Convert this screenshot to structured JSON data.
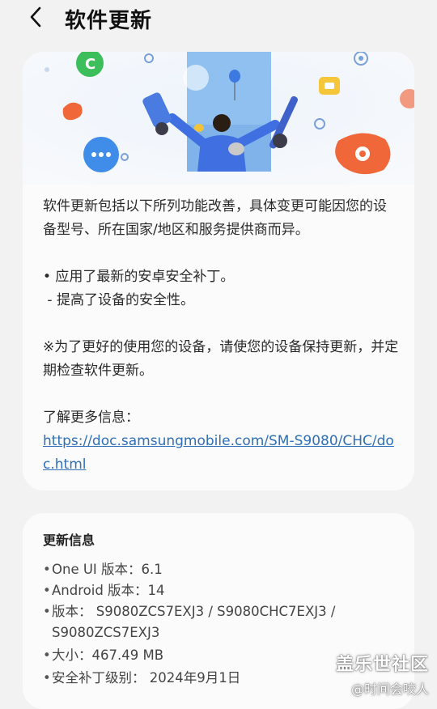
{
  "header": {
    "title": "软件更新"
  },
  "notes": {
    "intro": "软件更新包括以下所列功能改善，具体变更可能因您的设备型号、所在国家/地区和服务提供商而异。",
    "bullet_1": "• 应用了最新的安卓安全补丁。",
    "bullet_1_sub": " - 提高了设备的安全性。",
    "recommendation": "※为了更好的使用您的设备，请使您的设备保持更新，并定期检查软件更新。",
    "learn_more_label": "了解更多信息：",
    "learn_more_url": "https://doc.samsungmobile.com/SM-S9080/CHC/doc.html"
  },
  "update_info": {
    "title": "更新信息",
    "one_ui": "One UI 版本：6.1",
    "android": "Android 版本：14",
    "version": "版本：  S9080ZCS7EXJ3 / S9080CHC7EXJ3 / S9080ZCS7EXJ3",
    "size": "大小：467.49 MB",
    "security_patch": "安全补丁级别：  2024年9月1日"
  },
  "watermark": {
    "brand": "盖乐世社区",
    "author": "@时间会咬人"
  },
  "colors": {
    "link": "#2e6fb7",
    "banner_blue": "#4a7be0",
    "banner_orange": "#f0683a",
    "banner_green": "#3cbf5a",
    "banner_yellow": "#f5c53a"
  }
}
